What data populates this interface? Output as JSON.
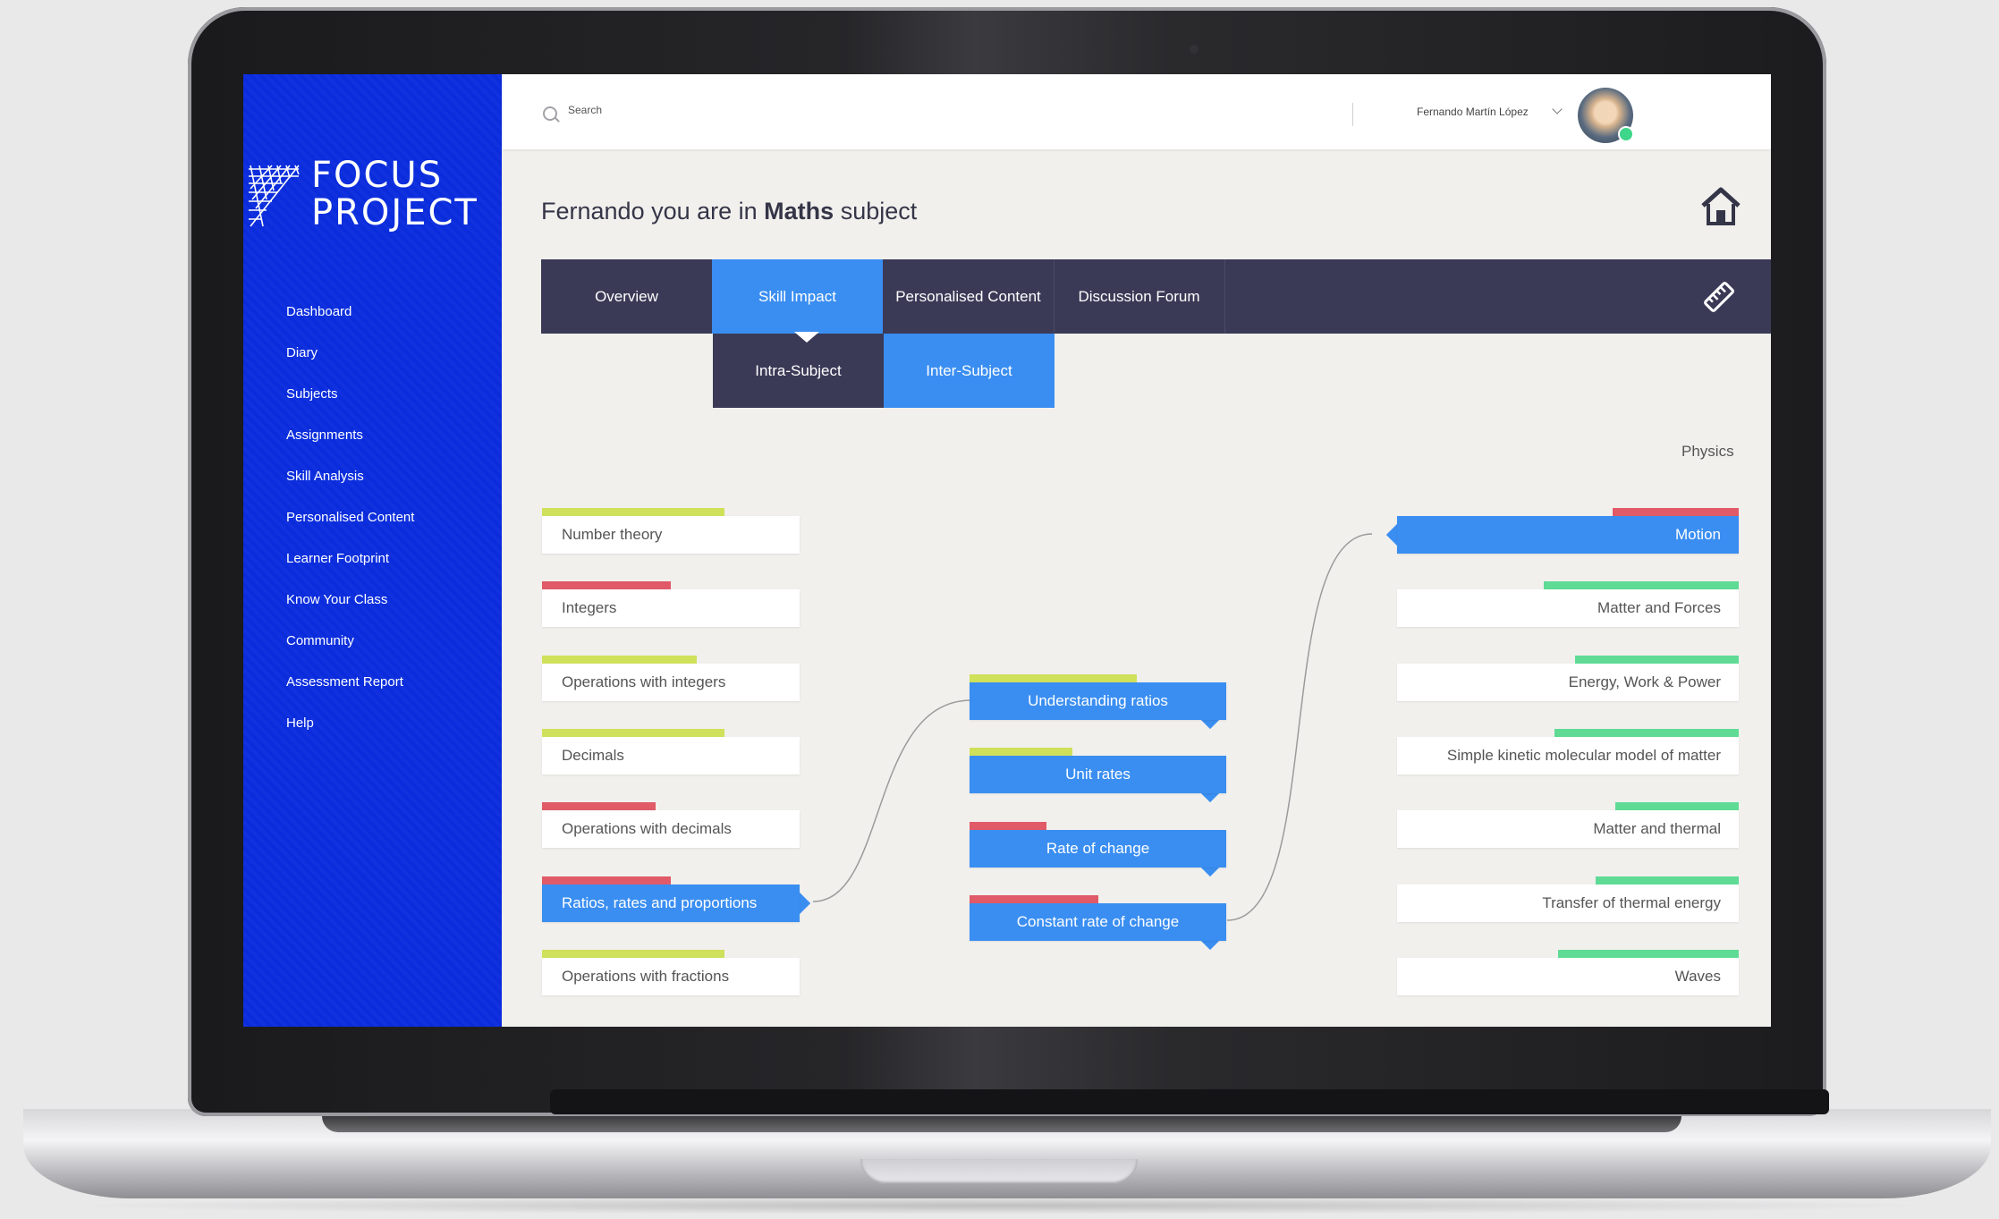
{
  "brand": {
    "line1": "FOCUS",
    "line2": "PROJECT"
  },
  "nav": [
    "Dashboard",
    "Diary",
    "Subjects",
    "Assignments",
    "Skill Analysis",
    "Personalised Content",
    "Learner Footprint",
    "Know Your Class",
    "Community",
    "Assessment Report",
    "Help"
  ],
  "search": {
    "placeholder": "Search"
  },
  "user": {
    "name": "Fernando Martín López"
  },
  "page": {
    "title_prefix": "Fernando you are in ",
    "subject": "Maths",
    "title_suffix": " subject"
  },
  "tabs": [
    "Overview",
    "Skill Impact",
    "Personalised Content",
    "Discussion Forum"
  ],
  "active_tab": "Skill Impact",
  "subtabs": [
    "Intra-Subject",
    "Inter-Subject"
  ],
  "active_subtab": "Inter-Subject",
  "related_subject": "Physics",
  "colors": {
    "sidebar": "#0a2cdc",
    "accent": "#3a8ef1",
    "tabbar": "#3a3a57",
    "good": "#5fdb95",
    "mid": "#cfe05a",
    "bad": "#e05a67"
  },
  "left_skills": [
    {
      "label": "Number theory",
      "level": "mid",
      "progress": 0.71
    },
    {
      "label": "Integers",
      "level": "bad",
      "progress": 0.5
    },
    {
      "label": "Operations with integers",
      "level": "mid",
      "progress": 0.6
    },
    {
      "label": "Decimals",
      "level": "mid",
      "progress": 0.71
    },
    {
      "label": "Operations with decimals",
      "level": "bad",
      "progress": 0.44
    },
    {
      "label": "Ratios, rates and proportions",
      "level": "bad",
      "progress": 0.5,
      "selected": true
    },
    {
      "label": "Operations with fractions",
      "level": "mid",
      "progress": 0.71
    }
  ],
  "middle_skills": [
    {
      "label": "Understanding ratios",
      "level": "mid",
      "progress": 0.65
    },
    {
      "label": "Unit rates",
      "level": "mid",
      "progress": 0.4
    },
    {
      "label": "Rate of change",
      "level": "bad",
      "progress": 0.3
    },
    {
      "label": "Constant rate of change",
      "level": "bad",
      "progress": 0.5
    }
  ],
  "right_skills": [
    {
      "label": "Motion",
      "level": "bad",
      "progress": 0.37,
      "selected": true
    },
    {
      "label": "Matter and Forces",
      "level": "good",
      "progress": 0.57
    },
    {
      "label": "Energy, Work & Power",
      "level": "good",
      "progress": 0.48
    },
    {
      "label": "Simple kinetic molecular model of matter",
      "level": "good",
      "progress": 0.54
    },
    {
      "label": "Matter and thermal",
      "level": "good",
      "progress": 0.36
    },
    {
      "label": "Transfer of thermal energy",
      "level": "good",
      "progress": 0.42
    },
    {
      "label": "Waves",
      "level": "good",
      "progress": 0.53
    }
  ]
}
